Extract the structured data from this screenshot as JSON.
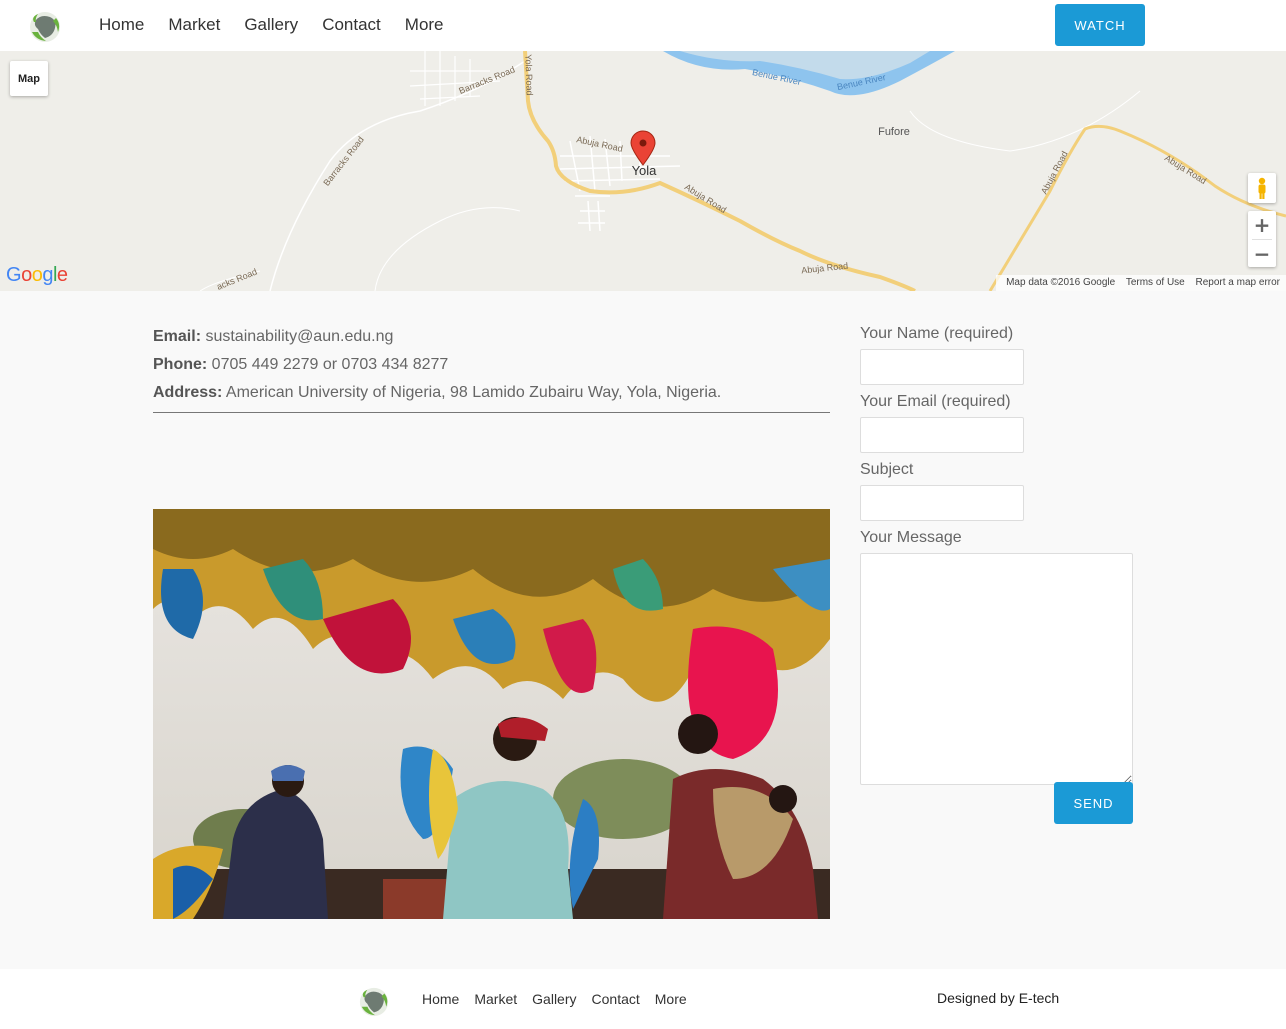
{
  "header": {
    "nav": [
      "Home",
      "Market",
      "Gallery",
      "Contact",
      "More"
    ],
    "watch_label": "WATCH"
  },
  "map": {
    "type_label": "Map",
    "labels": {
      "yola": "Yola",
      "fufore": "Fufore",
      "yola_road": "Yola Road",
      "barracks_road_1": "Barracks Road",
      "barracks_road_2": "Barracks Road",
      "abuja_road_1": "Abuja Road",
      "abuja_road_2": "Abuja Road",
      "abuja_road_3": "Abuja Road",
      "abuja_road_4": "Abuja Road",
      "abuja_road_5": "Abuja Road",
      "benue_river_1": "Benue River",
      "benue_river_2": "Benue River",
      "road_sw": "acks Road"
    },
    "google_logo": "Google",
    "footer": {
      "data": "Map data ©2016 Google",
      "terms": "Terms of Use",
      "report": "Report a map error"
    },
    "zoom_in": "+",
    "zoom_out": "−"
  },
  "contact": {
    "email_label": "Email:",
    "email_value": " sustainability@aun.edu.ng",
    "phone_label": "Phone:",
    "phone_value": " 0705 449 2279 or 0703 434 8277",
    "address_label": "Address:",
    "address_value": " American University of Nigeria, 98 Lamido Zubairu Way, Yola, Nigeria."
  },
  "form": {
    "name_label": "Your Name (required)",
    "email_label": "Your Email (required)",
    "subject_label": "Subject",
    "message_label": "Your Message",
    "send_label": "SEND"
  },
  "footer": {
    "nav": [
      "Home",
      "Market",
      "Gallery",
      "Contact",
      "More"
    ],
    "credit": "Designed by E-tech"
  },
  "colors": {
    "accent": "#1b9ad6",
    "map_bg": "#efeee9",
    "river": "#8ec4ee",
    "road": "#f2cf7a"
  }
}
